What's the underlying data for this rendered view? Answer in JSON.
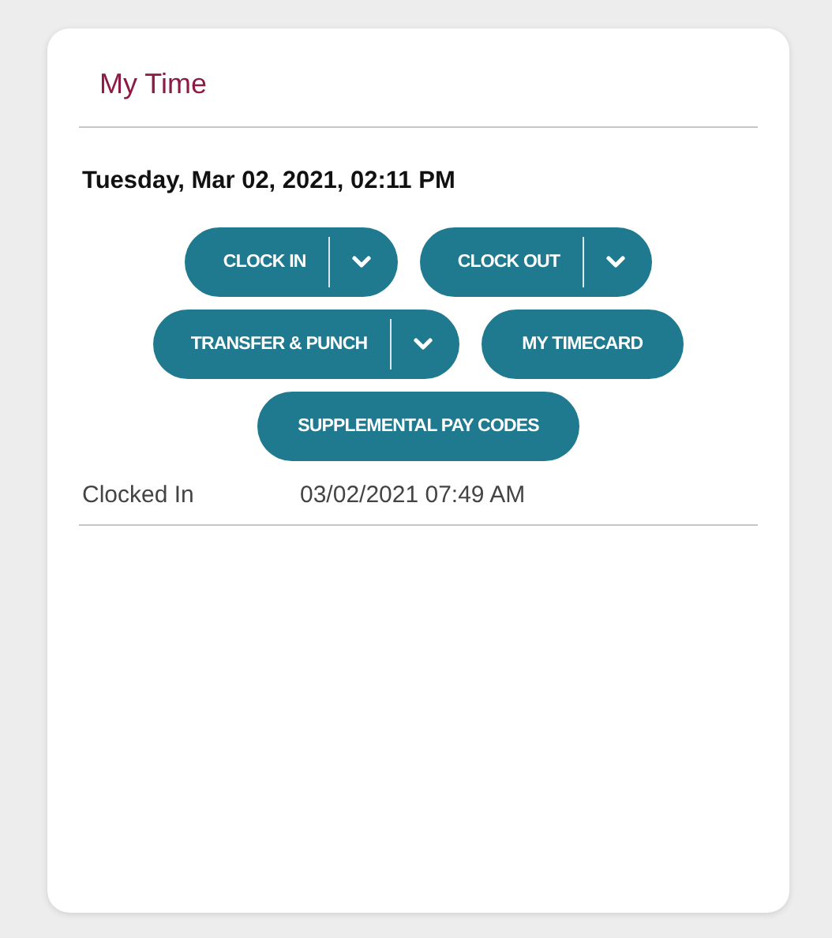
{
  "card": {
    "title": "My Time",
    "datetime": "Tuesday, Mar 02, 2021, 02:11 PM",
    "button_rows": [
      [
        {
          "label": "CLOCK IN",
          "kind": "split"
        },
        {
          "label": "CLOCK OUT",
          "kind": "split"
        }
      ],
      [
        {
          "label": "TRANSFER & PUNCH",
          "kind": "split"
        },
        {
          "label": "MY TIMECARD",
          "kind": "plain"
        }
      ],
      [
        {
          "label": "SUPPLEMENTAL PAY CODES",
          "kind": "plain"
        }
      ]
    ],
    "status": {
      "label": "Clocked In",
      "value": "03/02/2021 07:49 AM"
    }
  }
}
